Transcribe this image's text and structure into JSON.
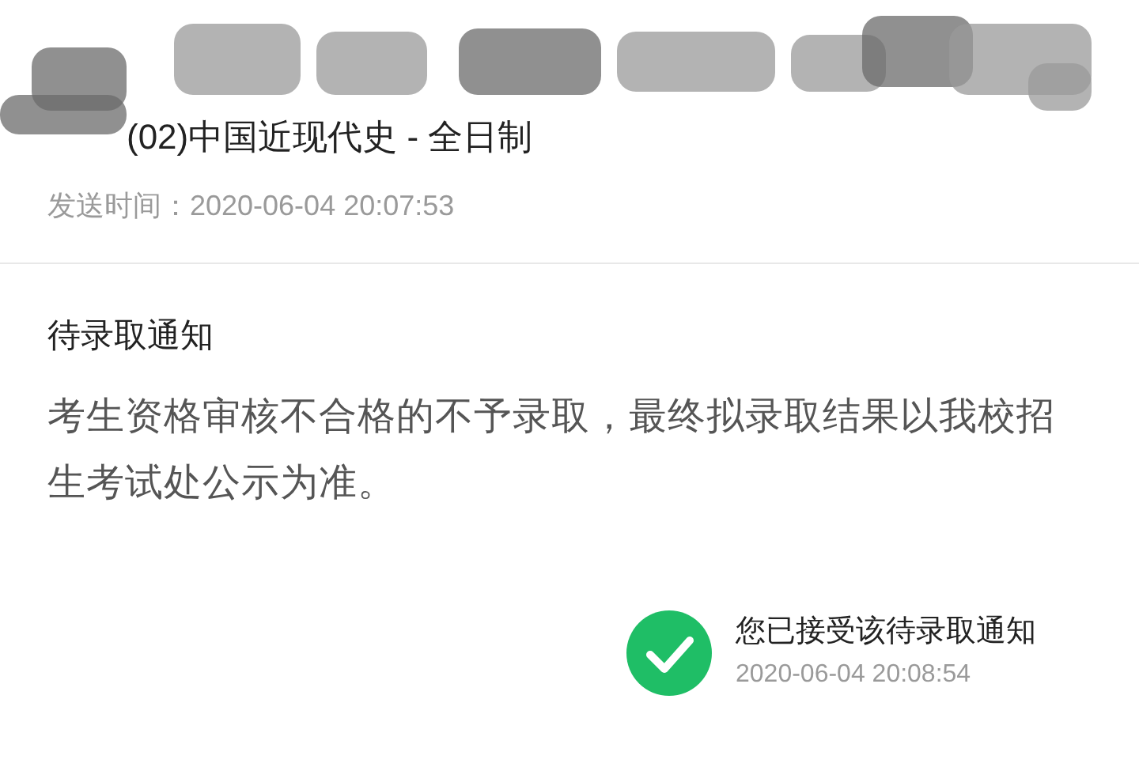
{
  "header": {
    "program": "(02)中国近现代史 - 全日制",
    "sent_label": "发送时间：",
    "sent_time": "2020-06-04 20:07:53"
  },
  "notice": {
    "title": "待录取通知",
    "body": "考生资格审核不合格的不予录取，最终拟录取结果以我校招生考试处公示为准。"
  },
  "status": {
    "accepted": true,
    "text": "您已接受该待录取通知",
    "time": "2020-06-04 20:08:54"
  }
}
